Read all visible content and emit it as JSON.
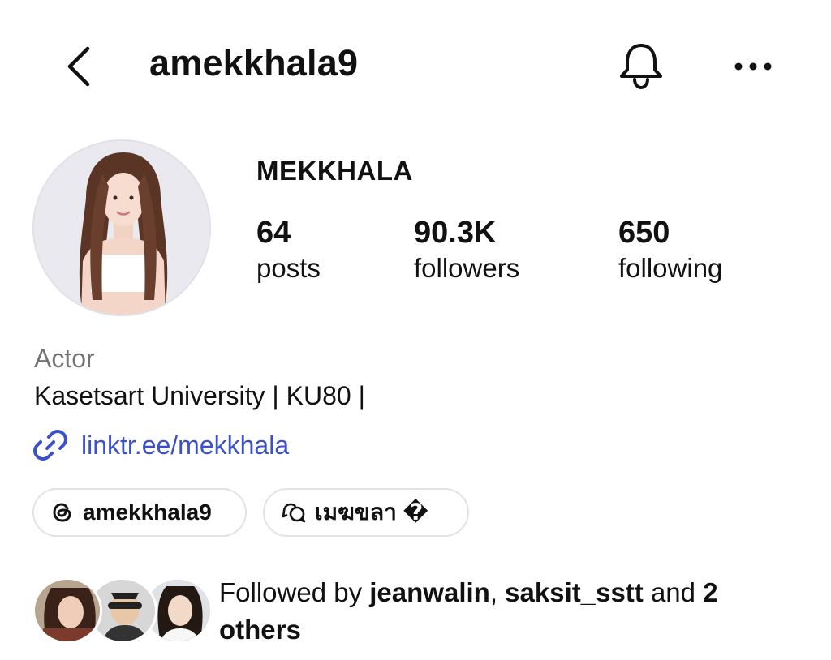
{
  "header": {
    "username": "amekkhala9",
    "back_icon": "chevron-left-icon",
    "bell_icon": "bell-icon",
    "more_icon": "more-horizontal-icon"
  },
  "profile": {
    "display_name": "MEKKHALA",
    "stats": [
      {
        "value": "64",
        "label": "posts"
      },
      {
        "value": "90.3K",
        "label": "followers"
      },
      {
        "value": "650",
        "label": "following"
      }
    ],
    "category": "Actor",
    "bio": "Kasetsart University | KU80 |",
    "link": "linktr.ee/mekkhala"
  },
  "chips": [
    {
      "icon": "threads-icon",
      "label": "amekkhala9"
    },
    {
      "icon": "chat-bubbles-icon",
      "label": "เมฆขลา �"
    }
  ],
  "followed_by": {
    "prefix": "Followed by ",
    "user1": "jeanwalin",
    "sep": ", ",
    "user2": "saksit_sstt",
    "mid": " and ",
    "rest": "2 others"
  },
  "colors": {
    "link": "#3b51c9",
    "muted": "#737373",
    "chip_border": "#e3e3e3"
  }
}
